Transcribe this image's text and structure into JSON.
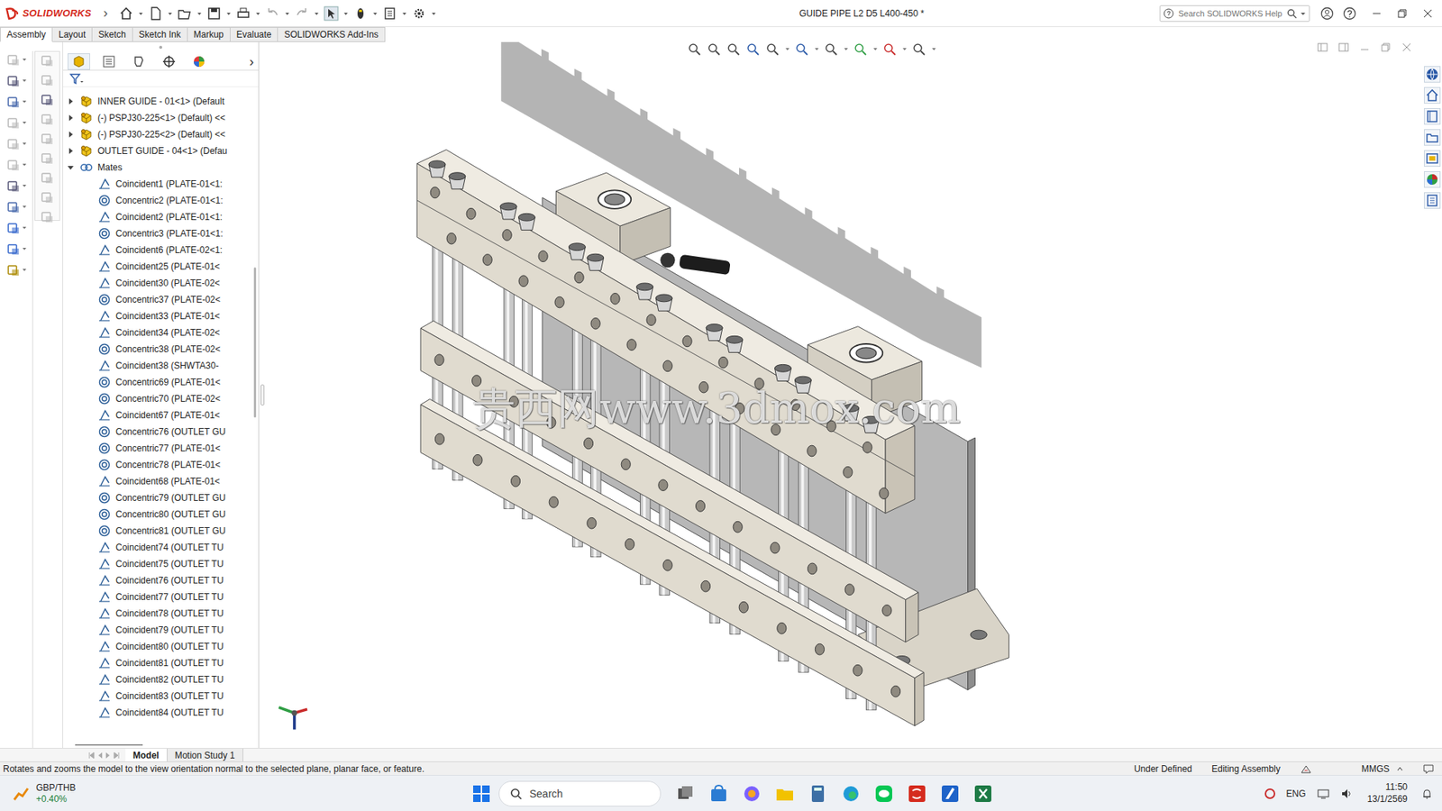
{
  "window": {
    "app": "SOLIDWORKS",
    "menu_arrow": "›",
    "title": "GUIDE PIPE L2 D5 L400-450 *"
  },
  "search": {
    "placeholder": "Search SOLIDWORKS Help"
  },
  "command_tabs": [
    {
      "label": "Assembly",
      "selected": true
    },
    {
      "label": "Layout",
      "selected": false
    },
    {
      "label": "Sketch",
      "selected": false
    },
    {
      "label": "Sketch Ink",
      "selected": false
    },
    {
      "label": "Markup",
      "selected": false
    },
    {
      "label": "Evaluate",
      "selected": false
    },
    {
      "label": "SOLIDWORKS Add-Ins",
      "selected": false
    }
  ],
  "tree": {
    "more": "›",
    "components": [
      {
        "label": "INNER GUIDE - 01<1> (Default",
        "expanded": false
      },
      {
        "label": "(-) PSPJ30-225<1> (Default) <<",
        "expanded": false
      },
      {
        "label": "(-) PSPJ30-225<2> (Default) <<",
        "expanded": false
      },
      {
        "label": "OUTLET GUIDE - 04<1> (Defau",
        "expanded": false
      }
    ],
    "mates_folder": {
      "label": "Mates",
      "expanded": true
    },
    "mates": [
      {
        "label": "Coincident1 (PLATE-01<1:",
        "kind": "coincident"
      },
      {
        "label": "Concentric2 (PLATE-01<1:",
        "kind": "concentric"
      },
      {
        "label": "Coincident2 (PLATE-01<1:",
        "kind": "coincident"
      },
      {
        "label": "Concentric3 (PLATE-01<1:",
        "kind": "concentric"
      },
      {
        "label": "Coincident6 (PLATE-02<1:",
        "kind": "coincident"
      },
      {
        "label": "Coincident25 (PLATE-01<",
        "kind": "coincident"
      },
      {
        "label": "Coincident30 (PLATE-02<",
        "kind": "coincident"
      },
      {
        "label": "Concentric37 (PLATE-02<",
        "kind": "concentric"
      },
      {
        "label": "Coincident33 (PLATE-01<",
        "kind": "coincident"
      },
      {
        "label": "Coincident34 (PLATE-02<",
        "kind": "coincident"
      },
      {
        "label": "Concentric38 (PLATE-02<",
        "kind": "concentric"
      },
      {
        "label": "Coincident38 (SHWTA30-",
        "kind": "coincident"
      },
      {
        "label": "Concentric69 (PLATE-01<",
        "kind": "concentric"
      },
      {
        "label": "Concentric70 (PLATE-02<",
        "kind": "concentric"
      },
      {
        "label": "Coincident67 (PLATE-01<",
        "kind": "coincident"
      },
      {
        "label": "Concentric76 (OUTLET GU",
        "kind": "concentric"
      },
      {
        "label": "Concentric77 (PLATE-01<",
        "kind": "concentric"
      },
      {
        "label": "Concentric78 (PLATE-01<",
        "kind": "concentric"
      },
      {
        "label": "Coincident68 (PLATE-01<",
        "kind": "coincident"
      },
      {
        "label": "Concentric79 (OUTLET GU",
        "kind": "concentric"
      },
      {
        "label": "Concentric80 (OUTLET GU",
        "kind": "concentric"
      },
      {
        "label": "Concentric81 (OUTLET GU",
        "kind": "concentric"
      },
      {
        "label": "Coincident74 (OUTLET TU",
        "kind": "coincident"
      },
      {
        "label": "Coincident75 (OUTLET TU",
        "kind": "coincident"
      },
      {
        "label": "Coincident76 (OUTLET TU",
        "kind": "coincident"
      },
      {
        "label": "Coincident77 (OUTLET TU",
        "kind": "coincident"
      },
      {
        "label": "Coincident78 (OUTLET TU",
        "kind": "coincident"
      },
      {
        "label": "Coincident79 (OUTLET TU",
        "kind": "coincident"
      },
      {
        "label": "Coincident80 (OUTLET TU",
        "kind": "coincident"
      },
      {
        "label": "Coincident81 (OUTLET TU",
        "kind": "coincident"
      },
      {
        "label": "Coincident82 (OUTLET TU",
        "kind": "coincident"
      },
      {
        "label": "Coincident83 (OUTLET TU",
        "kind": "coincident"
      },
      {
        "label": "Coincident84 (OUTLET TU",
        "kind": "coincident"
      }
    ]
  },
  "bottom_tabs": [
    {
      "label": "Model",
      "selected": true
    },
    {
      "label": "Motion Study 1",
      "selected": false
    }
  ],
  "watermark": "贵西网www.3dmox.com",
  "status_bar": {
    "message": "Rotates and zooms the model to the view orientation normal to the selected plane, planar face, or feature.",
    "state": "Under Defined",
    "mode": "Editing Assembly",
    "units": "MMGS"
  },
  "taskbar": {
    "widget": {
      "title": "GBP/THB",
      "change": "+0.40%"
    },
    "search": "Search",
    "language": "ENG",
    "time": "11:50",
    "date": "13/1/2569"
  }
}
